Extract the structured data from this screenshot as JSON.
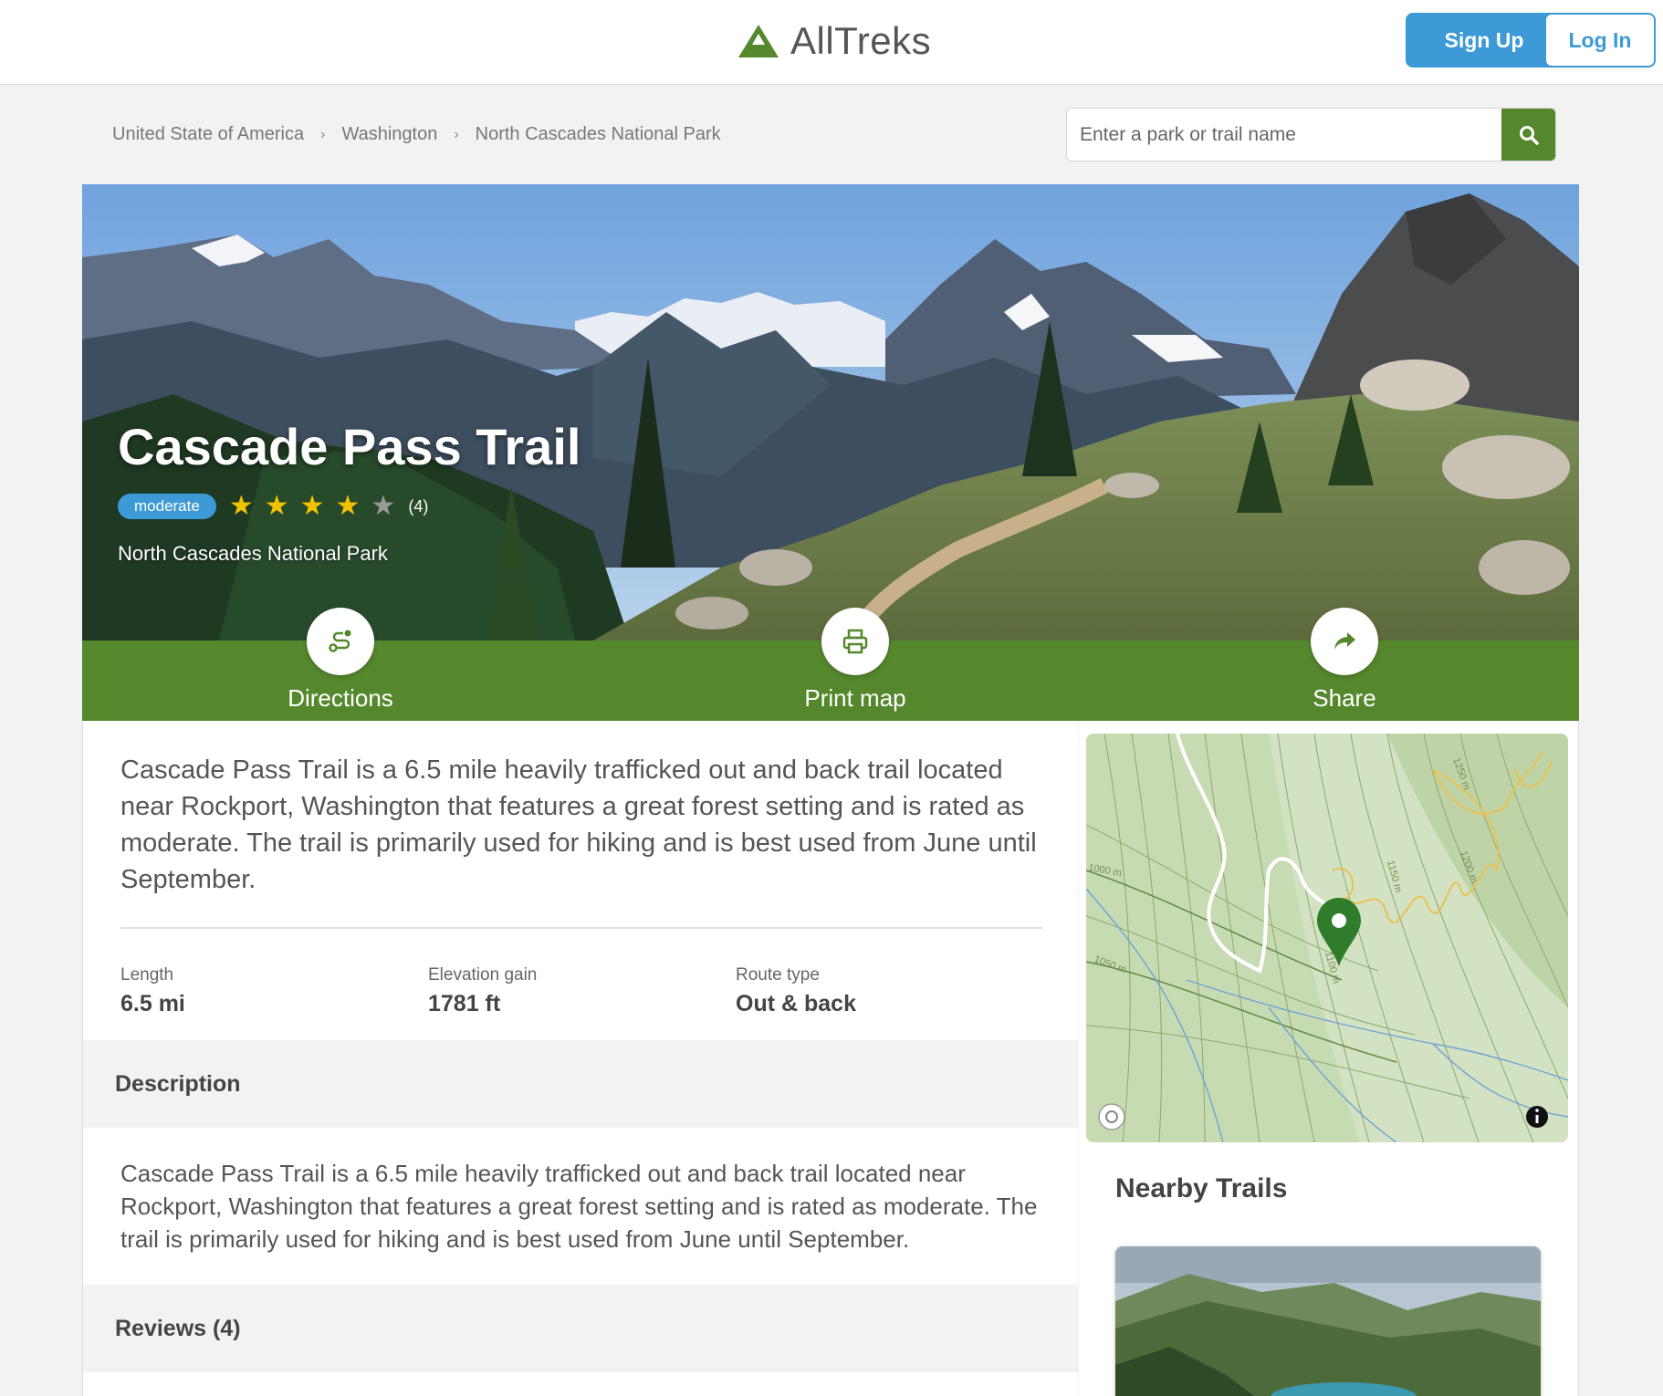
{
  "header": {
    "brand": "AllTreks",
    "signup_label": "Sign Up",
    "login_label": "Log In",
    "brand_color": "#55882d",
    "accent_color": "#3d9ad6"
  },
  "breadcrumb": [
    "United State of America",
    "Washington",
    "North Cascades National Park"
  ],
  "search": {
    "placeholder": "Enter a park or trail name",
    "value": ""
  },
  "trail": {
    "title": "Cascade Pass Trail",
    "difficulty": "moderate",
    "rating": 4,
    "rating_max": 5,
    "review_count": "(4)",
    "park": "North Cascades National Park"
  },
  "actions": [
    {
      "label": "Directions",
      "icon": "directions-icon"
    },
    {
      "label": "Print map",
      "icon": "printer-icon"
    },
    {
      "label": "Share",
      "icon": "share-icon"
    }
  ],
  "summary": "Cascade Pass Trail is a 6.5 mile heavily trafficked out and back trail located near Rockport, Washington that features a great forest setting and is rated as moderate. The trail is primarily used for hiking and is best used from June until September.",
  "stats": [
    {
      "label": "Length",
      "value": "6.5 mi"
    },
    {
      "label": "Elevation gain",
      "value": "1781 ft"
    },
    {
      "label": "Route type",
      "value": "Out & back"
    }
  ],
  "description": {
    "heading": "Description",
    "text": "Cascade Pass Trail is a 6.5 mile heavily trafficked out and back trail located near Rockport, Washington that features a great forest setting and is rated as moderate. The trail is primarily used for hiking and is best used from June until September."
  },
  "reviews": {
    "heading": "Reviews (4)"
  },
  "map": {
    "contour_labels": [
      "1250 m",
      "1200 m",
      "1150 m",
      "1100 m",
      "1000 m",
      "1050 m"
    ]
  },
  "nearby": {
    "heading": "Nearby Trails"
  }
}
